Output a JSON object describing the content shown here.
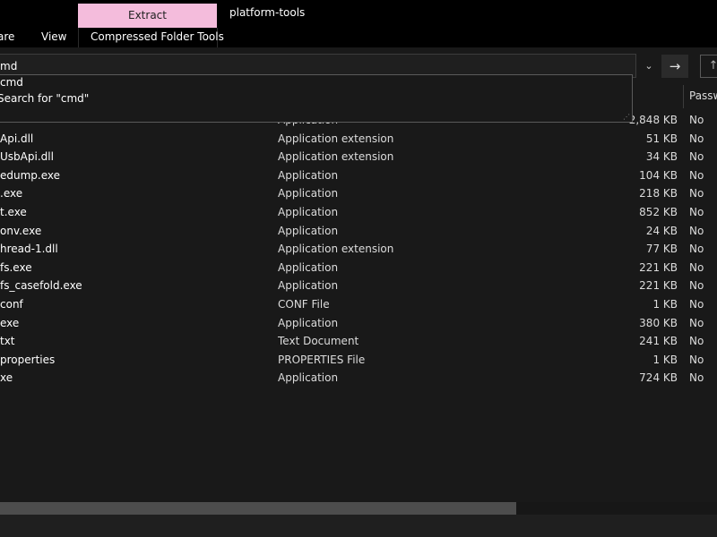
{
  "ribbon": {
    "context_tab": "Extract",
    "window_title": "platform-tools",
    "tabs": [
      "are",
      "View"
    ],
    "context_group": "Compressed Folder Tools"
  },
  "search": {
    "value": "md",
    "suggestions": [
      "cmd",
      "Search for \"cmd\""
    ]
  },
  "nav": {
    "go_icon": "→",
    "up_icon": "↑",
    "dropdown_icon": "⌄"
  },
  "columns": {
    "password": "Passw"
  },
  "files": [
    {
      "name": "",
      "type": "Application",
      "size": "2,848 KB",
      "pw": "No"
    },
    {
      "name": "Api.dll",
      "type": "Application extension",
      "size": "51 KB",
      "pw": "No"
    },
    {
      "name": "UsbApi.dll",
      "type": "Application extension",
      "size": "34 KB",
      "pw": "No"
    },
    {
      "name": "edump.exe",
      "type": "Application",
      "size": "104 KB",
      "pw": "No"
    },
    {
      "name": ".exe",
      "type": "Application",
      "size": "218 KB",
      "pw": "No"
    },
    {
      "name": "t.exe",
      "type": "Application",
      "size": "852 KB",
      "pw": "No"
    },
    {
      "name": "onv.exe",
      "type": "Application",
      "size": "24 KB",
      "pw": "No"
    },
    {
      "name": "hread-1.dll",
      "type": "Application extension",
      "size": "77 KB",
      "pw": "No"
    },
    {
      "name": "fs.exe",
      "type": "Application",
      "size": "221 KB",
      "pw": "No"
    },
    {
      "name": "fs_casefold.exe",
      "type": "Application",
      "size": "221 KB",
      "pw": "No"
    },
    {
      "name": "conf",
      "type": "CONF File",
      "size": "1 KB",
      "pw": "No"
    },
    {
      "name": "exe",
      "type": "Application",
      "size": "380 KB",
      "pw": "No"
    },
    {
      "name": "txt",
      "type": "Text Document",
      "size": "241 KB",
      "pw": "No"
    },
    {
      "name": "properties",
      "type": "PROPERTIES File",
      "size": "1 KB",
      "pw": "No"
    },
    {
      "name": "xe",
      "type": "Application",
      "size": "724 KB",
      "pw": "No"
    }
  ],
  "scroll": {
    "horizontal_position": 0.0,
    "visible_fraction": 0.72
  }
}
